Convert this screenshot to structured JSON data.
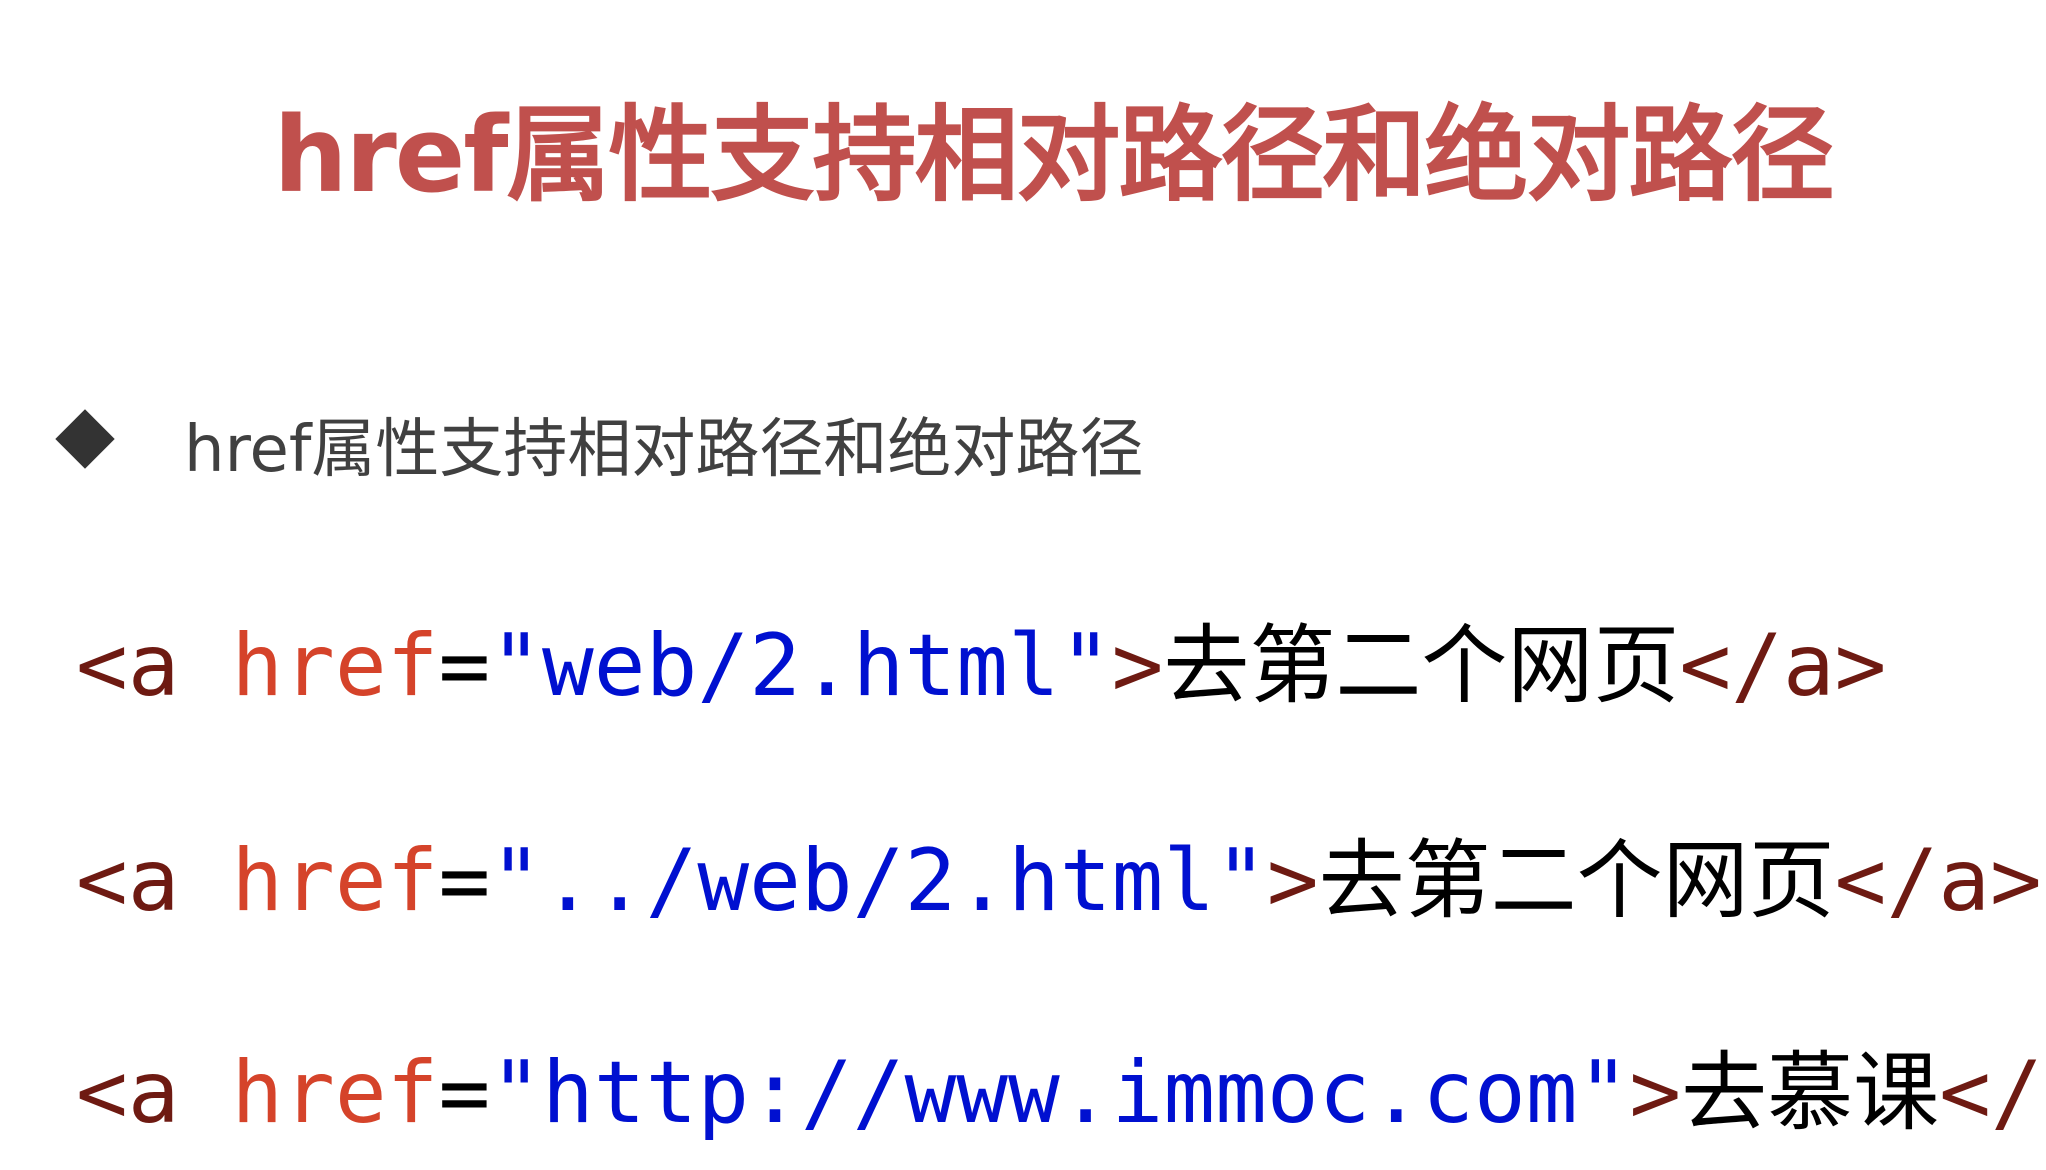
{
  "title": "href属性支持相对路径和绝对路径",
  "bullet": "href属性支持相对路径和绝对路径",
  "code_lines": [
    {
      "open": "<a ",
      "attr": "href",
      "eq": "=",
      "value": "\"web/2.html\"",
      "close": ">",
      "text": "去第二个网页",
      "end": "</a>"
    },
    {
      "open": "<a ",
      "attr": "href",
      "eq": "=",
      "value": "\"../web/2.html\"",
      "close": ">",
      "text": "去第二个网页",
      "end": "</a>"
    },
    {
      "open": "<a ",
      "attr": "href",
      "eq": "=",
      "value": "\"http://www.immoc.com\"",
      "close": ">",
      "text": "去慕课",
      "end": "</a>"
    }
  ],
  "colors": {
    "title": "#c0504d",
    "tag": "#6e1a12",
    "attribute": "#d5432a",
    "string": "#0010d0"
  }
}
